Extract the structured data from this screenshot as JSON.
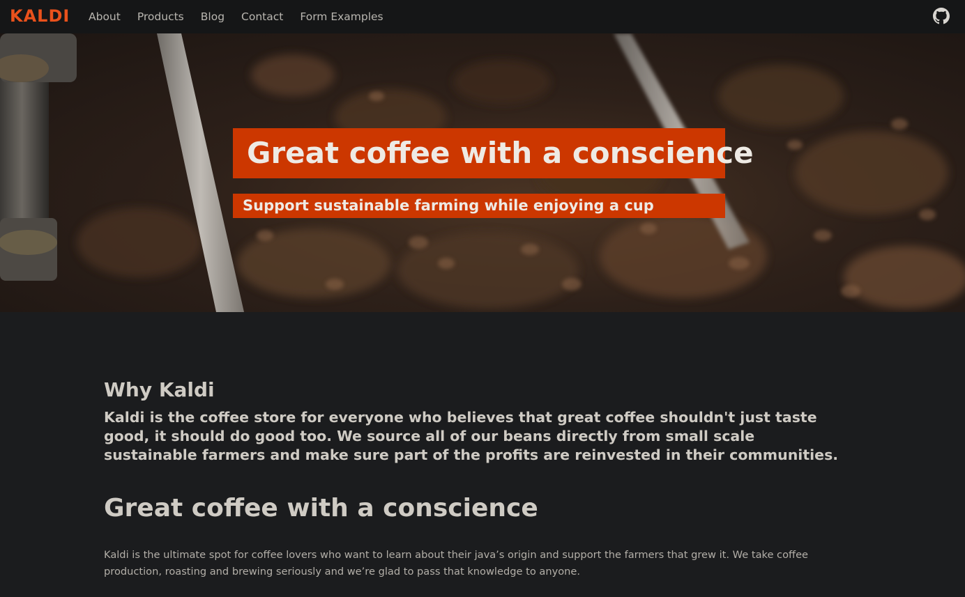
{
  "navbar": {
    "brand": "KALDI",
    "links": [
      "About",
      "Products",
      "Blog",
      "Contact",
      "Form Examples"
    ],
    "github_icon": "github-icon"
  },
  "hero": {
    "title": "Great coffee with a conscience",
    "subtitle": "Support sustainable farming while enjoying a cup"
  },
  "why": {
    "heading": "Why Kaldi",
    "description": "Kaldi is the coffee store for everyone who believes that great coffee shouldn't just taste good, it should do good too. We source all of our beans directly from small scale sustainable farmers and make sure part of the profits are reinvested in their communities."
  },
  "intro": {
    "heading": "Great coffee with a conscience",
    "text": "Kaldi is the ultimate spot for coffee lovers who want to learn about their java’s origin and support the farmers that grew it. We take coffee production, roasting and brewing seriously and we’re glad to pass that knowledge to anyone."
  },
  "colors": {
    "accent": "#cc3700",
    "brand": "#e9511c",
    "background": "#1b1c1e",
    "navbar": "#151617"
  }
}
